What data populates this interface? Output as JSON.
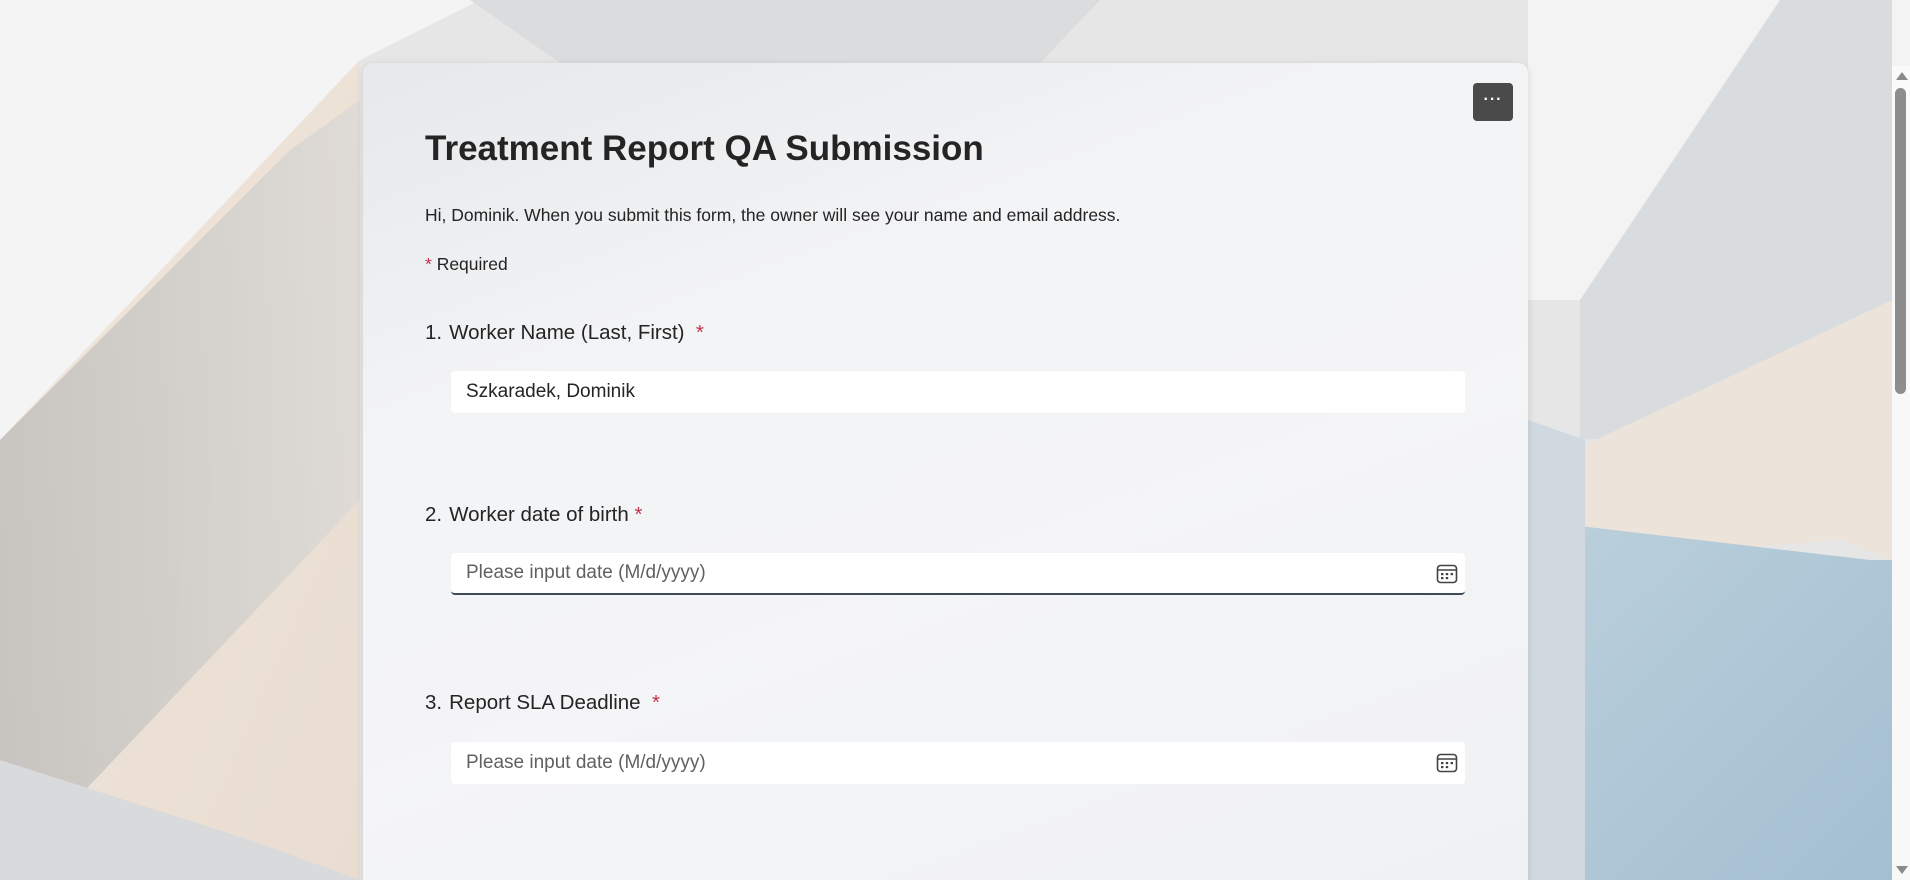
{
  "form": {
    "title": "Treatment Report QA Submission",
    "intro": "Hi, Dominik. When you submit this form, the owner will see your name and email address.",
    "required_marker": "*",
    "required_label": "Required",
    "more_label": "···"
  },
  "questions": [
    {
      "number": "1.",
      "label": "Worker Name (Last, First)",
      "required": "*",
      "value": "Szkaradek, Dominik",
      "placeholder": ""
    },
    {
      "number": "2.",
      "label": "Worker date of birth",
      "required": "*",
      "value": "",
      "placeholder": "Please input date (M/d/yyyy)",
      "icon": "calendar-icon"
    },
    {
      "number": "3.",
      "label": "Report SLA Deadline",
      "required": "*",
      "value": "",
      "placeholder": "Please input date (M/d/yyyy)",
      "icon": "calendar-icon"
    }
  ],
  "colors": {
    "required": "#c4314b",
    "more_button": "#4a4a4a",
    "text": "#242424"
  }
}
